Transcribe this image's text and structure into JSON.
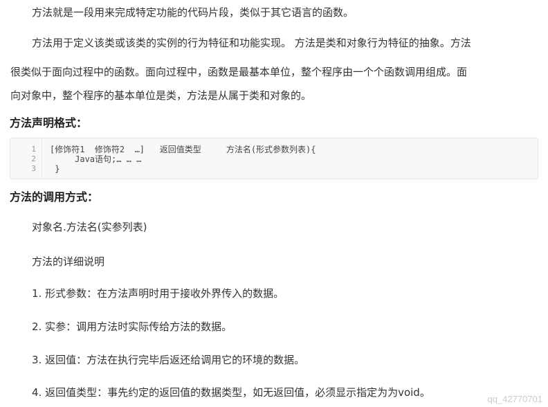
{
  "intro": "方法就是一段用来完成特定功能的代码片段，类似于其它语言的函数。",
  "desc": {
    "line1": "方法用于定义该类或该类的实例的行为特征和功能实现。 方法是类和对象行为特征的抽象。方法",
    "line2": "很类似于面向过程中的函数。面向过程中，函数是最基本单位，整个程序由一个个函数调用组成。面",
    "line3": "向对象中，整个程序的基本单位是类，方法是从属于类和对象的。"
  },
  "declaration": {
    "heading": "方法声明格式：",
    "code_lines": [
      {
        "num": "1",
        "text": "[修饰符1  修饰符2  …]   返回值类型     方法名(形式参数列表){"
      },
      {
        "num": "2",
        "text": "     Java语句;… … …"
      },
      {
        "num": "3",
        "text": " }"
      }
    ]
  },
  "invocation": {
    "heading": "方法的调用方式：",
    "syntax": "对象名.方法名(实参列表)",
    "detail_title": "方法的详细说明",
    "items": [
      "1. 形式参数：在方法声明时用于接收外界传入的数据。",
      "2. 实参：调用方法时实际传给方法的数据。",
      "3. 返回值：方法在执行完毕后返还给调用它的环境的数据。",
      "4. 返回值类型：事先约定的返回值的数据类型，如无返回值，必须显示指定为为void。"
    ]
  },
  "watermark": "qq_42770701"
}
